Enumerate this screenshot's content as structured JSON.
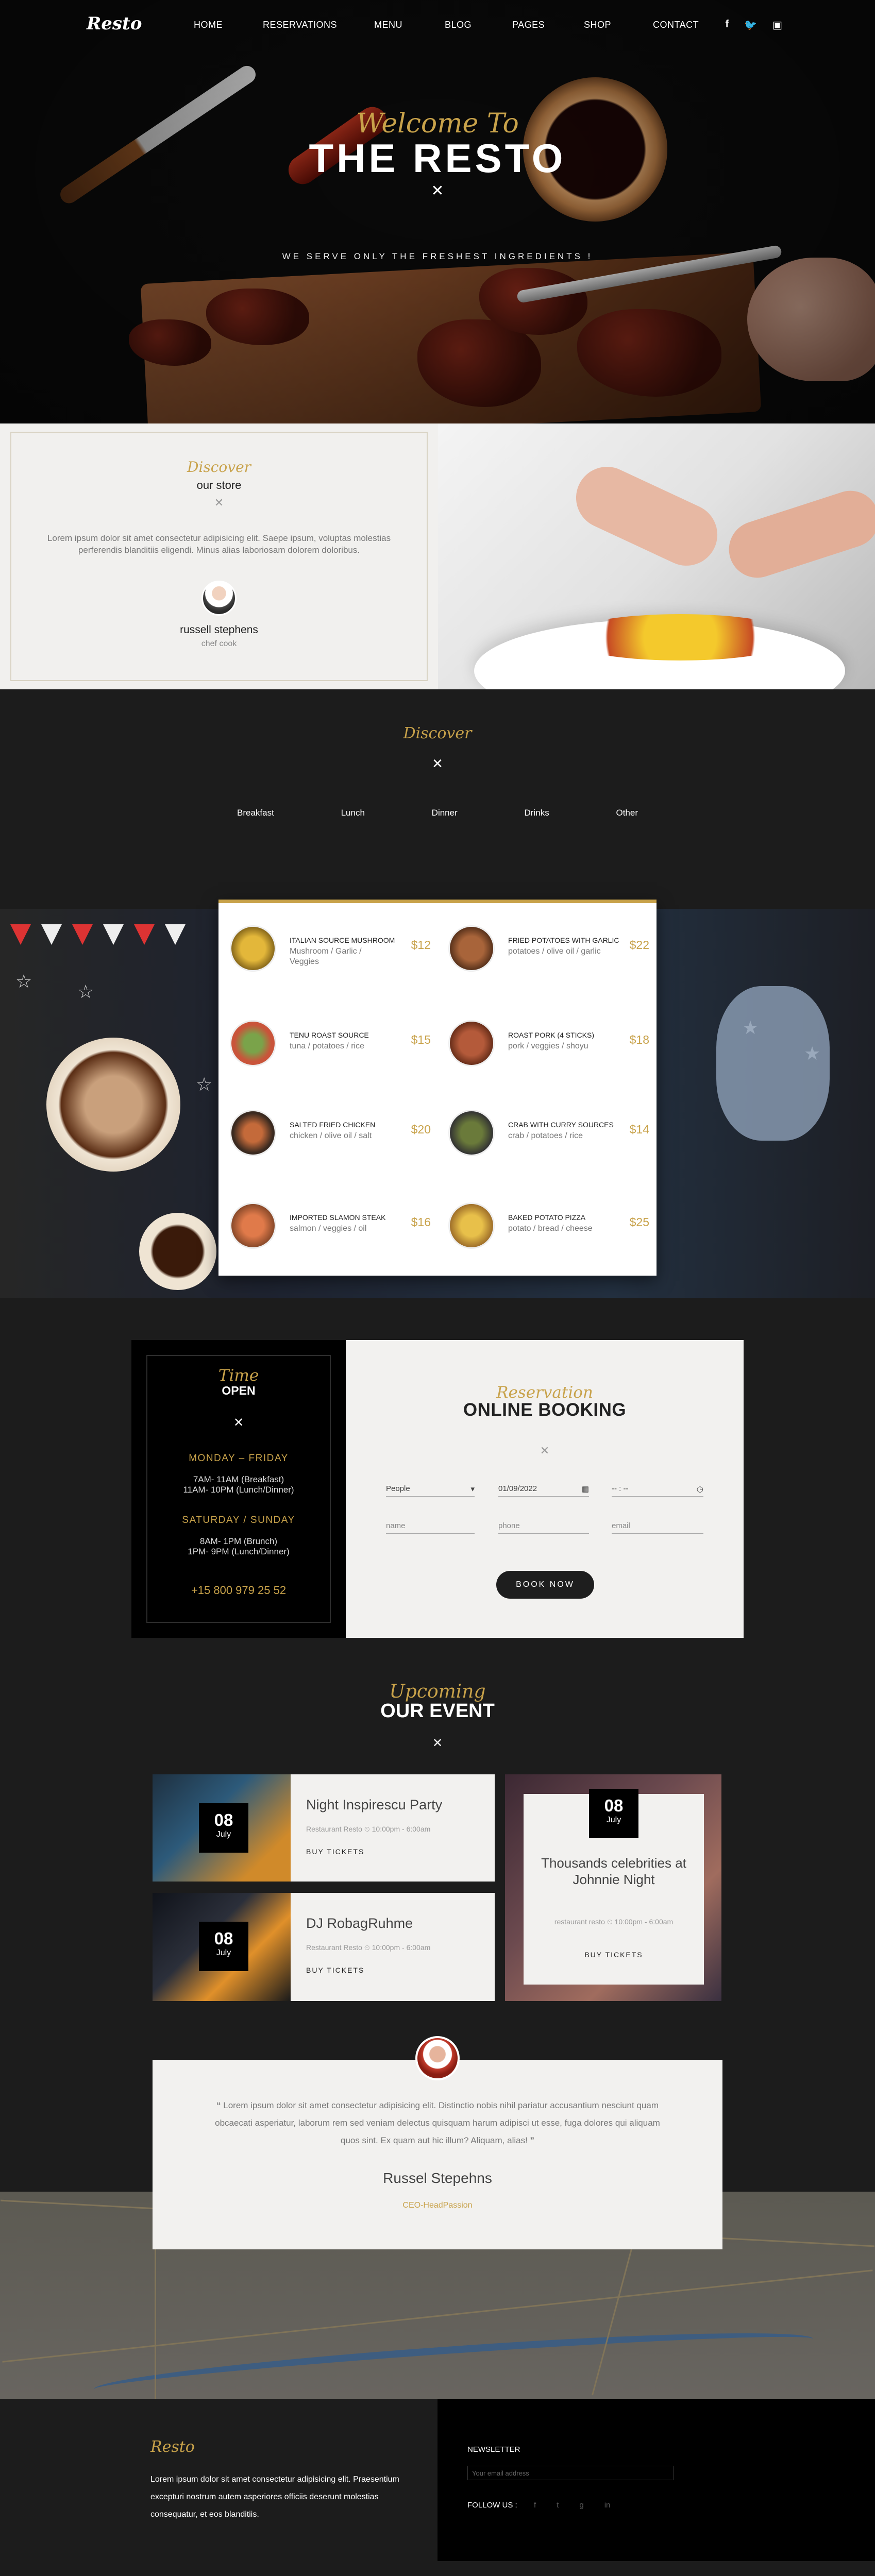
{
  "nav": {
    "logo": "Resto",
    "items": [
      "HOME",
      "RESERVATIONS",
      "MENU",
      "BLOG",
      "PAGES",
      "SHOP",
      "CONTACT"
    ],
    "social": [
      "f",
      "t",
      "ig"
    ]
  },
  "hero": {
    "script": "Welcome To",
    "title": "THE RESTO",
    "tagline": "WE SERVE ONLY THE FRESHEST INGREDIENTS !"
  },
  "store": {
    "script": "Discover",
    "title": "our store",
    "text": "Lorem ipsum dolor sit amet consectetur adipisicing elit. Saepe ipsum, voluptas molestias perferendis blanditiis eligendi. Minus alias laboriosam dolorem doloribus.",
    "name": "russell stephens",
    "role": "chef cook"
  },
  "menu": {
    "script": "Discover",
    "tabs": [
      "Breakfast",
      "Lunch",
      "Dinner",
      "Drinks",
      "Other"
    ],
    "dishes": [
      {
        "name": "ITALIAN SOURCE MUSHROOM",
        "ingredients": "Mushroom / Garlic / Veggies",
        "price": "$12"
      },
      {
        "name": "FRIED POTATOES WITH GARLIC",
        "ingredients": "potatoes / olive oil / garlic",
        "price": "$22"
      },
      {
        "name": "TENU ROAST SOURCE",
        "ingredients": "tuna / potatoes / rice",
        "price": "$15"
      },
      {
        "name": "ROAST PORK (4 STICKS)",
        "ingredients": "pork / veggies / shoyu",
        "price": "$18"
      },
      {
        "name": "SALTED FRIED CHICKEN",
        "ingredients": "chicken / olive oil / salt",
        "price": "$20"
      },
      {
        "name": "CRAB WITH CURRY SOURCES",
        "ingredients": "crab / potatoes / rice",
        "price": "$14"
      },
      {
        "name": "IMPORTED SLAMON STEAK",
        "ingredients": "salmon / veggies / oil",
        "price": "$16"
      },
      {
        "name": "BAKED POTATO PIZZA",
        "ingredients": "potato / bread / cheese",
        "price": "$25"
      }
    ]
  },
  "hours": {
    "script": "Time",
    "title": "OPEN",
    "weekday_label": "MONDAY – FRIDAY",
    "weekday_l1": "7AM- 11AM (Breakfast)",
    "weekday_l2": "11AM- 10PM (Lunch/Dinner)",
    "weekend_label": "SATURDAY / SUNDAY",
    "weekend_l1": "8AM- 1PM (Brunch)",
    "weekend_l2": "1PM- 9PM (Lunch/Dinner)",
    "phone": "+15 800 979 25 52"
  },
  "booking": {
    "script": "Reservation",
    "title": "ONLINE BOOKING",
    "people": "People",
    "date": "01/09/2022",
    "time": "-- : --",
    "name": "name",
    "phone": "phone",
    "email": "email",
    "button": "BOOK NOW"
  },
  "events": {
    "script": "Upcoming",
    "title": "OUR EVENT",
    "items": [
      {
        "day": "08",
        "month": "July",
        "title": "Night Inspirescu Party",
        "meta": "Restaurant Resto  ⏲ 10:00pm - 6:00am",
        "buy": "BUY TICKETS"
      },
      {
        "day": "08",
        "month": "July",
        "title": "DJ RobagRuhme",
        "meta": "Restaurant Resto  ⏲ 10:00pm - 6:00am",
        "buy": "BUY TICKETS"
      },
      {
        "day": "08",
        "month": "July",
        "title": "Thousands celebrities at Johnnie Night",
        "meta": "restaurant resto  ⏲ 10:00pm - 6:00am",
        "buy": "BUY TICKETS"
      }
    ]
  },
  "testimonial": {
    "text": "Lorem ipsum dolor sit amet consectetur adipisicing elit. Distinctio nobis nihil pariatur accusantium nesciunt quam obcaecati asperiatur, laborum rem sed veniam delectus quisquam harum adipisci ut esse, fuga dolores qui aliquam quos sint. Ex quam aut hic illum? Aliquam, alias!",
    "name": "Russel Stepehns",
    "title": "CEO-HeadPassion"
  },
  "footer": {
    "logo": "Resto",
    "text": "Lorem ipsum dolor sit amet consectetur adipisicing elit. Praesentium excepturi nostrum autem asperiores officiis deserunt molestias consequatur, et eos blanditiis.",
    "newsletter": "NEWSLETTER",
    "email_placeholder": "Your email address",
    "follow": "FOLLOW US :",
    "icons": [
      "f",
      "t",
      "g",
      "in"
    ]
  },
  "colors": {
    "accent": "#c8a24a",
    "dark": "#1c1c1c",
    "card": "#f2f1ef"
  }
}
